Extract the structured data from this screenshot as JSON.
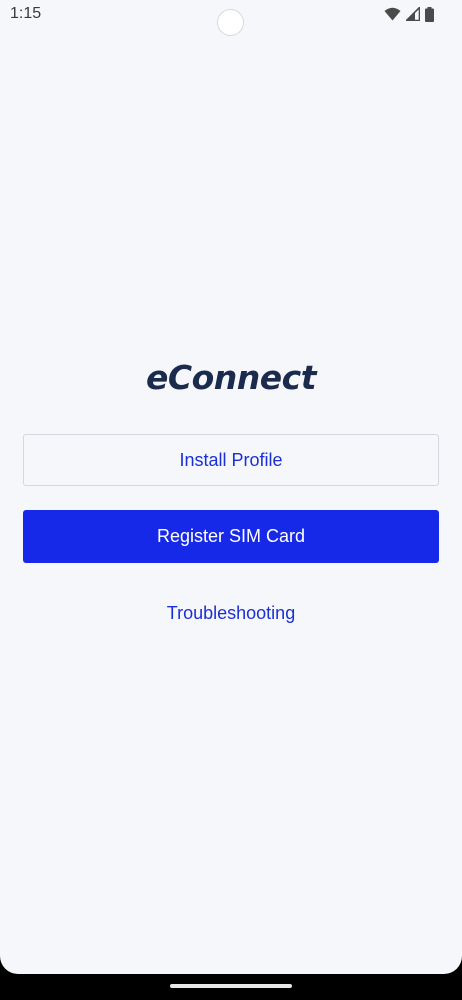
{
  "status_bar": {
    "time": "1:15",
    "icons": [
      "wifi-icon",
      "signal-icon",
      "battery-icon"
    ]
  },
  "logo": {
    "text": "eConnect"
  },
  "buttons": {
    "install_profile": "Install Profile",
    "register_sim": "Register SIM Card"
  },
  "links": {
    "troubleshooting": "Troubleshooting"
  },
  "colors": {
    "primary": "#1729e8",
    "link": "#1b2fd6",
    "logo": "#1a2b4e",
    "background": "#f6f7fb"
  }
}
